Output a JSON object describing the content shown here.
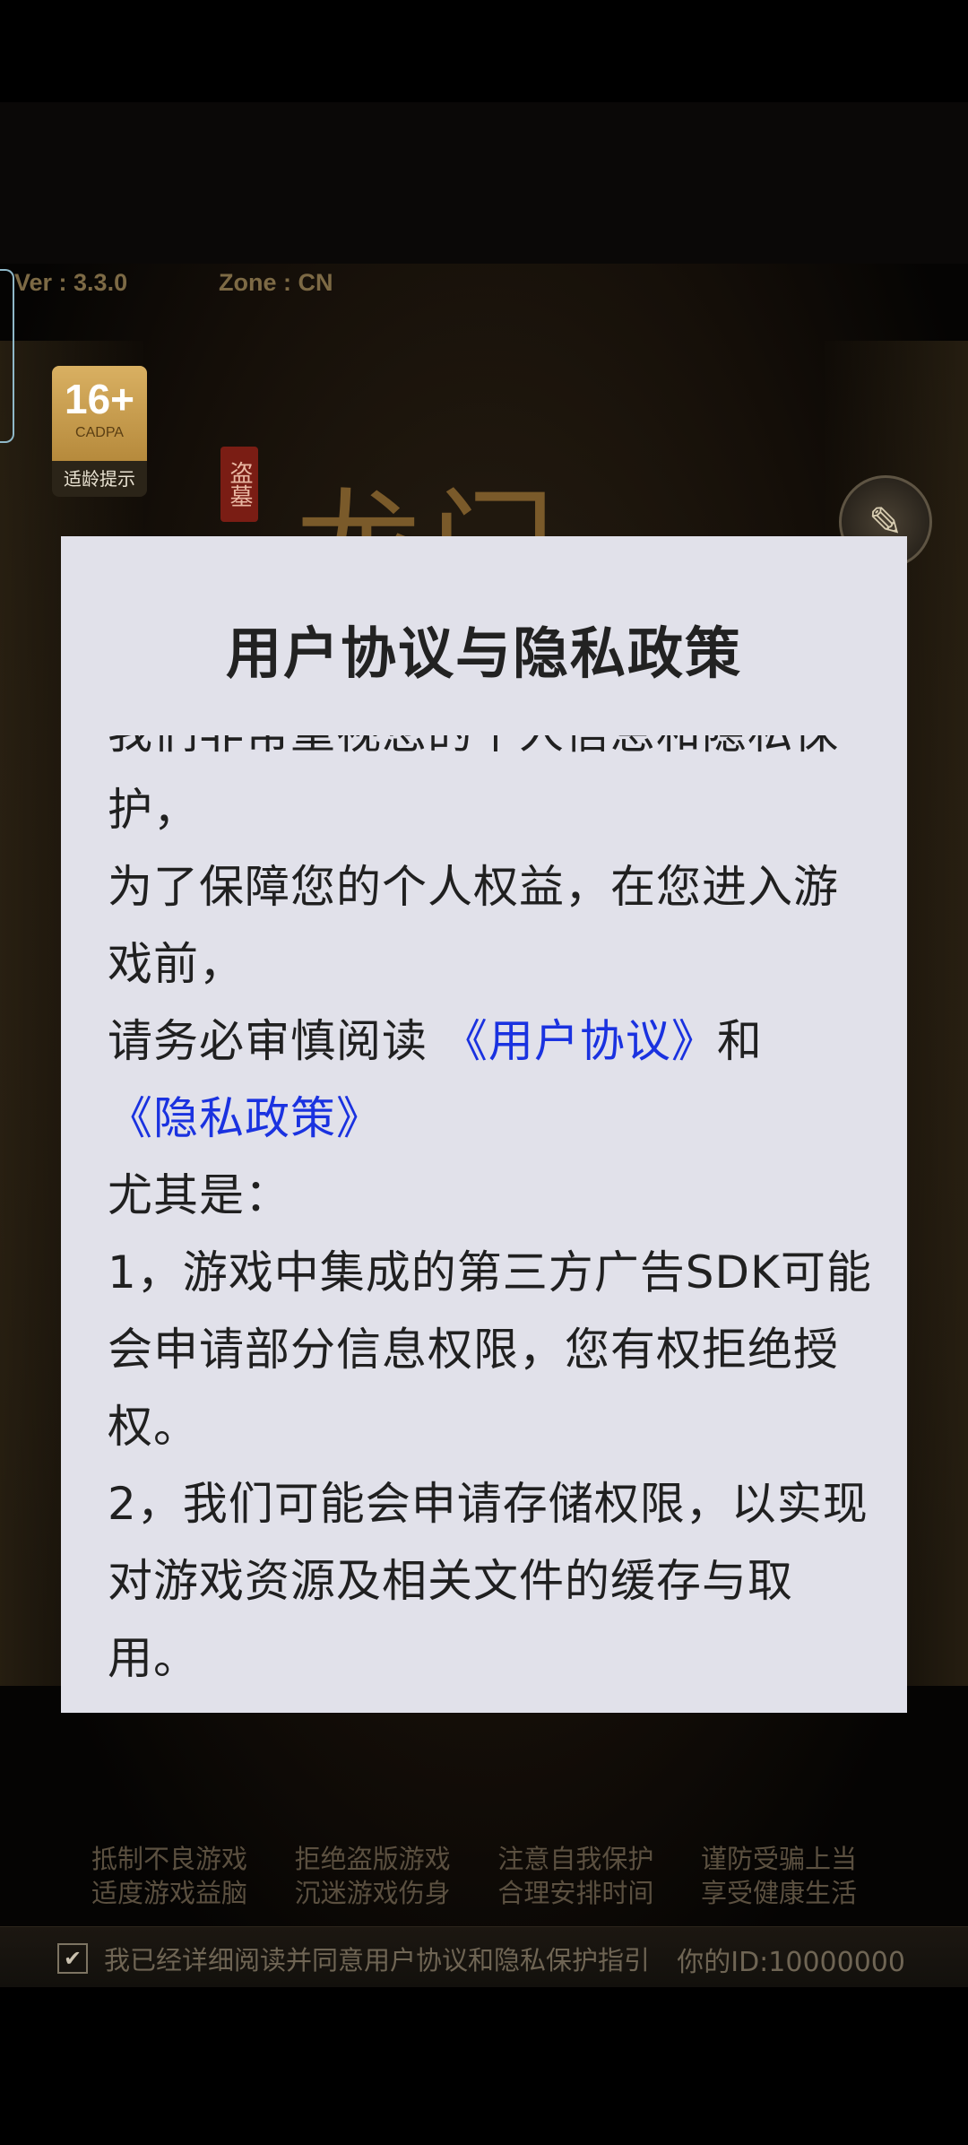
{
  "header": {
    "version": "Ver : 3.3.0",
    "zone": "Zone : CN"
  },
  "age_badge": {
    "rating": "16+",
    "org": "CADPA",
    "label": "适龄提示"
  },
  "seal_text": "盗墓",
  "logo_text": "龙门",
  "right_icon": "notice-icon",
  "dialog": {
    "title": "用户协议与隐私政策",
    "paragraphs": [
      "我们非常重视您的个人信息和隐私保护，",
      "为了保障您的个人权益，在您进入游戏前，"
    ],
    "read_prefix": "请务必审慎阅读 ",
    "user_agreement_link": "《用户协议》",
    "and_text": "和",
    "privacy_policy_link": "《隐私政策》",
    "especially": "尤其是：",
    "point1": "1，游戏中集成的第三方广告SDK可能会申请部分信息权限，您有权拒绝授权。",
    "point2": "2，我们可能会申请存储权限，以实现对游戏资源及相关文件的缓存与取用。"
  },
  "footer": {
    "tips_row1": [
      "抵制不良游戏",
      "拒绝盗版游戏",
      "注意自我保护",
      "谨防受骗上当"
    ],
    "tips_row2": [
      "适度游戏益脑",
      "沉迷游戏伤身",
      "合理安排时间",
      "享受健康生活"
    ],
    "consent_text": "我已经详细阅读并同意用户协议和隐私保护指引",
    "player_id": "你的ID:10000000"
  },
  "colors": {
    "dialog_bg": "#e1e1ea",
    "link": "#1a32e0"
  }
}
